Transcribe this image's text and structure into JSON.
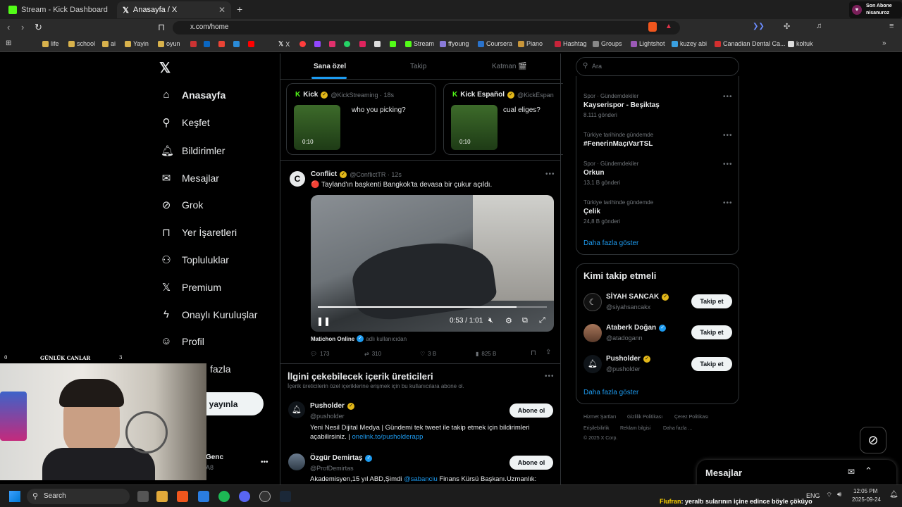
{
  "browser": {
    "tabs": [
      {
        "title": "Stream - Kick Dashboard",
        "color": "#53fc18"
      },
      {
        "title": "Anasayfa / X",
        "color": "#ffffff"
      }
    ],
    "url": "x.com/home",
    "bookmarks": [
      "life",
      "school",
      "ai",
      "Yayin",
      "oyun",
      "X",
      "Stream",
      "ffyoung",
      "Coursera",
      "Piano",
      "Hashtag",
      "Groups",
      "Lightshot",
      "kuzey abi",
      "Canadian Dental Ca...",
      "koltuk"
    ],
    "overlay_sub": {
      "line1": "Son Abone",
      "line2": "nisanuroz"
    }
  },
  "nav": {
    "items": [
      {
        "label": "Anasayfa",
        "icon": "home-icon"
      },
      {
        "label": "Keşfet",
        "icon": "search-icon"
      },
      {
        "label": "Bildirimler",
        "icon": "bell-icon"
      },
      {
        "label": "Mesajlar",
        "icon": "mail-icon"
      },
      {
        "label": "Grok",
        "icon": "grok-icon"
      },
      {
        "label": "Yer İşaretleri",
        "icon": "bookmark-icon"
      },
      {
        "label": "Topluluklar",
        "icon": "communities-icon"
      },
      {
        "label": "Premium",
        "icon": "x-icon"
      },
      {
        "label": "Onaylı Kuruluşlar",
        "icon": "lightning-icon"
      },
      {
        "label": "Profil",
        "icon": "profile-icon"
      },
      {
        "label": "fazla",
        "icon": "more-icon"
      }
    ],
    "post_button": "i yayınla",
    "account_name": "Genc",
    "account_handle": "A8"
  },
  "center": {
    "tabs": [
      "Sana özel",
      "Takip",
      "Katman 🎬"
    ],
    "kick_cards": [
      {
        "name": "Kick",
        "handle": "@KickStreaming · 18s",
        "text": "who you picking?",
        "duration": "0:10"
      },
      {
        "name": "Kick Español",
        "handle": "@KickEspan",
        "text": "cual eliges?",
        "duration": "0:10"
      }
    ],
    "post": {
      "name": "Conflict",
      "handle": "@ConflictTR · 12s",
      "text": "🔴 Tayland'ın başkenti Bangkok'ta devasa bir çukur açıldı.",
      "video_time": "0:53 / 1:01",
      "video_progress": 0.868,
      "source_name": "Matichon Online",
      "source_note": "adlı kullanıcıdan",
      "replies": "173",
      "reposts": "310",
      "likes": "3 B",
      "views": "825 B"
    },
    "creators": {
      "title": "İlgini çekebilecek içerik üreticileri",
      "subtitle": "İçerik üreticilerin özel içeriklerine erişmek için bu kullanıcılara abone ol.",
      "button": "Abone ol",
      "items": [
        {
          "name": "Pusholder",
          "handle": "@pusholder",
          "bio": "Yeni Nesil Dijital Medya | Gündemi tek tweet ile takip etmek için bildirimleri açabilirsiniz. |",
          "link": "onelink.to/pusholderapp"
        },
        {
          "name": "Özgür Demirtaş",
          "handle": "@ProfDemirtas",
          "bio": "Akademisyen,15 yıl ABD,Şimdi",
          "mention": "@sabanciu",
          "bio_end": "Finans Kürsü Başkanı.Uzmanlık:"
        }
      ]
    }
  },
  "right": {
    "search_placeholder": "Ara",
    "trends": [
      {
        "category": "Spor · Gündemdekiler",
        "name": "Kayserispor - Beşiktaş",
        "count": "8.111 gönderi"
      },
      {
        "category": "Türkiye tarihinde gündemde",
        "name": "#FenerinMaçıVarTSL",
        "count": ""
      },
      {
        "category": "Spor · Gündemdekiler",
        "name": "Orkun",
        "count": "13,1 B gönderi"
      },
      {
        "category": "Türkiye tarihinde gündemde",
        "name": "Çelik",
        "count": "24,8 B gönderi"
      }
    ],
    "show_more": "Daha fazla göster",
    "who_to_follow_title": "Kimi takip etmeli",
    "follow_button": "Takip et",
    "follow": [
      {
        "name": "SİYAH SANCAK",
        "handle": "@siyahsancakx"
      },
      {
        "name": "Ataberk Doğan",
        "handle": "@atadogann"
      },
      {
        "name": "Pusholder",
        "handle": "@pusholder"
      }
    ],
    "footer": [
      "Hizmet Şartları",
      "Gizlilik Politikası",
      "Çerez Politikası",
      "Erişilebilirlik",
      "Reklam bilgisi",
      "Daha fazla ...",
      "© 2025 X Corp."
    ],
    "messages_title": "Mesajlar"
  },
  "overlay": {
    "widget_title": "GÜNLÜK CANLAR",
    "widget_left": "0",
    "widget_right": "3",
    "ticker_user": "Flufran",
    "ticker_text": ": yeraltı sularının içine edince böyle çöküyo"
  },
  "taskbar": {
    "search": "Search",
    "lang": "ENG",
    "time": "12:05 PM",
    "date": "2025-09-24"
  }
}
